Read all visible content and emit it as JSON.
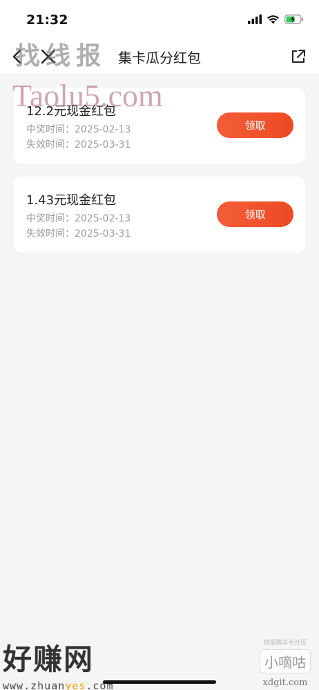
{
  "status_bar": {
    "time": "21:32"
  },
  "nav": {
    "title": "集卡瓜分红包",
    "back_icon": "chevron-left-icon",
    "close_icon": "close-icon",
    "share_icon": "share-external-icon"
  },
  "rewards": [
    {
      "title": "12.2元现金红包",
      "win_time": "中奖时间：2025-02-13",
      "expire_time": "失效时间：2025-03-31",
      "button_label": "领取"
    },
    {
      "title": "1.43元现金红包",
      "win_time": "中奖时间：2025-02-13",
      "expire_time": "失效时间：2025-03-31",
      "button_label": "领取"
    }
  ],
  "watermarks": {
    "top_text": "找线报",
    "taolu": "Taolu5.com",
    "hzw_name": "好赚网",
    "hzw_url_prefix": "www.zhuan",
    "hzw_url_yes": "yes",
    "hzw_url_suffix": ".com",
    "xdg_small": "线报薅羊毛社区",
    "xdg_name": "小嘀咕",
    "xdg_url": "xdgit.com"
  },
  "colors": {
    "button_gradient_start": "#f35d38",
    "button_gradient_end": "#ee4a23",
    "background": "#f5f5f5",
    "card": "#ffffff"
  }
}
